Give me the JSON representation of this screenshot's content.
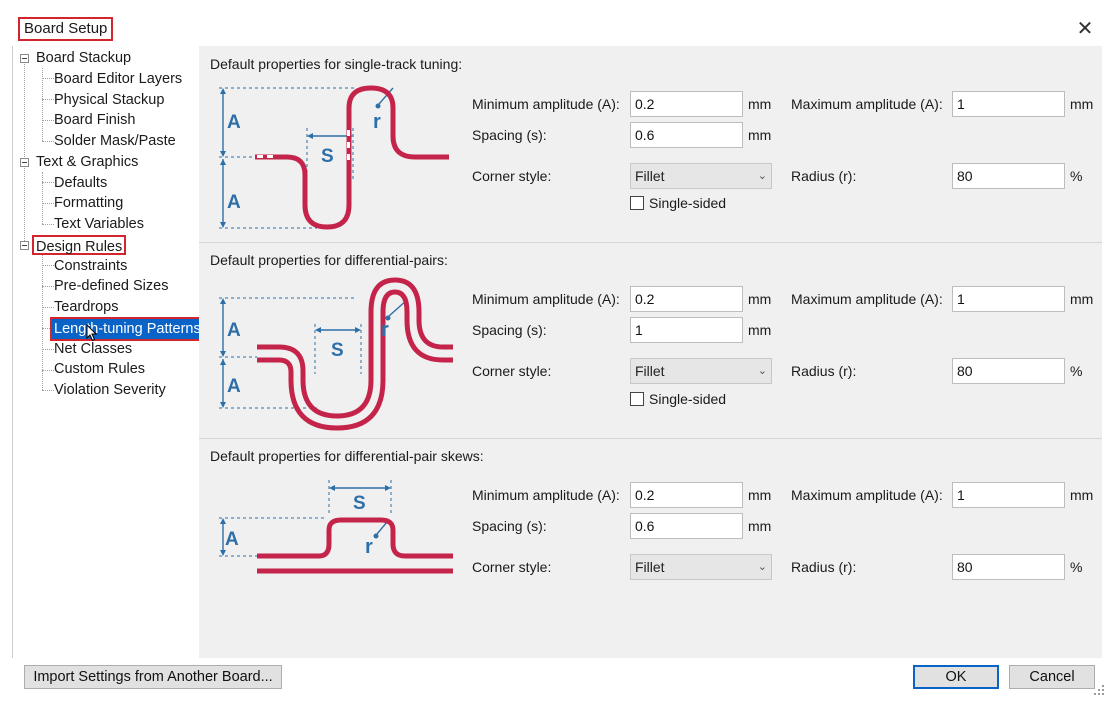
{
  "window": {
    "title": "Board Setup",
    "close_glyph": "✕"
  },
  "tree": {
    "items": [
      {
        "label": "Board Stackup",
        "level": "parent",
        "expanded": true
      },
      {
        "label": "Board Editor Layers",
        "level": "child"
      },
      {
        "label": "Physical Stackup",
        "level": "child"
      },
      {
        "label": "Board Finish",
        "level": "child"
      },
      {
        "label": "Solder Mask/Paste",
        "level": "child"
      },
      {
        "label": "Text & Graphics",
        "level": "parent",
        "expanded": true
      },
      {
        "label": "Defaults",
        "level": "child"
      },
      {
        "label": "Formatting",
        "level": "child"
      },
      {
        "label": "Text Variables",
        "level": "child"
      },
      {
        "label": "Design Rules",
        "level": "parent",
        "expanded": true,
        "highlighted": true
      },
      {
        "label": "Constraints",
        "level": "child"
      },
      {
        "label": "Pre-defined Sizes",
        "level": "child"
      },
      {
        "label": "Teardrops",
        "level": "child"
      },
      {
        "label": "Length-tuning Patterns",
        "level": "child",
        "selected": true
      },
      {
        "label": "Net Classes",
        "level": "child"
      },
      {
        "label": "Custom Rules",
        "level": "child"
      },
      {
        "label": "Violation Severity",
        "level": "child"
      }
    ]
  },
  "labels": {
    "min_amp": "Minimum amplitude (A):",
    "max_amp": "Maximum amplitude (A):",
    "spacing": "Spacing (s):",
    "corner": "Corner style:",
    "radius": "Radius (r):",
    "single_sided": "Single-sided",
    "mm": "mm",
    "percent": "%"
  },
  "sections": [
    {
      "title": "Default properties for single-track tuning:",
      "min_amplitude": "0.2",
      "max_amplitude": "1",
      "spacing": "0.6",
      "corner_style": "Fillet",
      "radius": "80",
      "single_sided": false
    },
    {
      "title": "Default properties for differential-pairs:",
      "min_amplitude": "0.2",
      "max_amplitude": "1",
      "spacing": "1",
      "corner_style": "Fillet",
      "radius": "80",
      "single_sided": false
    },
    {
      "title": "Default properties for differential-pair skews:",
      "min_amplitude": "0.2",
      "max_amplitude": "1",
      "spacing": "0.6",
      "corner_style": "Fillet",
      "radius": "80"
    }
  ],
  "diagram_labels": {
    "amplitude": "A",
    "spacing": "S",
    "radius": "r"
  },
  "footer": {
    "import_button": "Import Settings from Another Board...",
    "ok_button": "OK",
    "cancel_button": "Cancel"
  },
  "colors": {
    "trace": "#c4244a",
    "dimension": "#2e6fa8",
    "selection": "#0a64c8",
    "highlight": "#d2252e"
  }
}
